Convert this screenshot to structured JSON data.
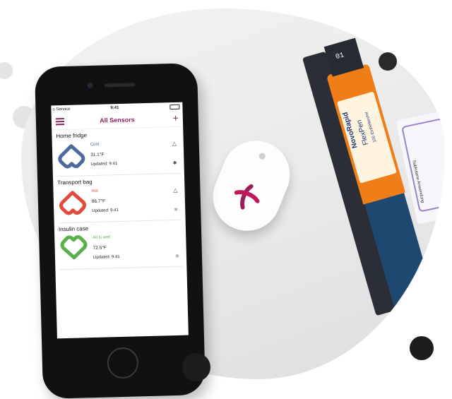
{
  "status_bar": {
    "carrier": "o Service",
    "time": "9:41"
  },
  "nav": {
    "title": "All Sensors",
    "add_label": "+"
  },
  "colors": {
    "accent": "#8a1e5e",
    "cold": "#4a6b9c",
    "hot": "#e14b3b",
    "ok": "#5ab04a"
  },
  "sensors": [
    {
      "name": "Home fridge",
      "status": "Cold",
      "temp": "31.1°F",
      "updated": "Updated: 9:41",
      "icon": "heart-cold-icon"
    },
    {
      "name": "Transport bag",
      "status": "Hot",
      "temp": "86.7°F",
      "updated": "Updated: 9:41",
      "icon": "heart-hot-icon"
    },
    {
      "name": "Insulin case",
      "status": "All is well",
      "temp": "72.5°F",
      "updated": "Updated: 9:41",
      "icon": "heart-ok-icon"
    }
  ],
  "pen": {
    "brand": "NovoRapid",
    "model": "FlexPen",
    "label": "100 Einheiten/ml",
    "dose": "01"
  },
  "box": {
    "text": "Subkutane Anwendung"
  }
}
